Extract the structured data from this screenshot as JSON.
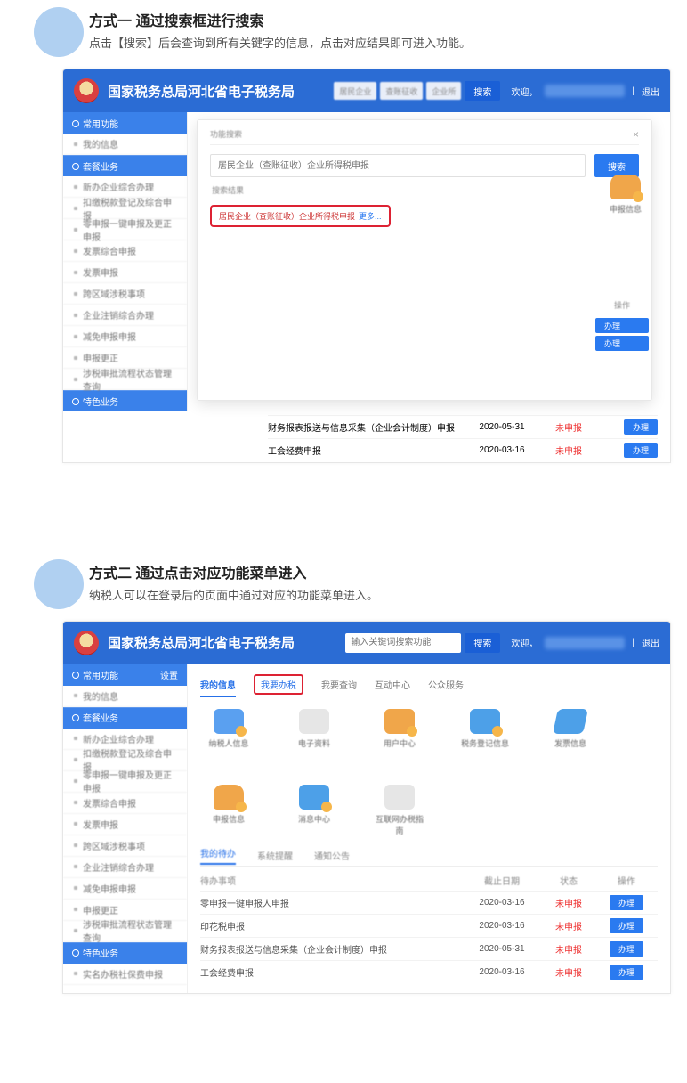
{
  "section1": {
    "title": "方式一 通过搜索框进行搜索",
    "subtitle": "点击【搜索】后会查询到所有关键字的信息，点击对应结果即可进入功能。"
  },
  "section2": {
    "title": "方式二 通过点击对应功能菜单进入",
    "subtitle": "纳税人可以在登录后的页面中通过对应的功能菜单进入。"
  },
  "header": {
    "app_title": "国家税务总局河北省电子税务局",
    "pill1": "居民企业",
    "pill2": "查账征收",
    "pill3": "企业所",
    "search_btn": "搜索",
    "search_placeholder": "输入关键词搜索功能",
    "welcome": "欢迎，",
    "logout": "退出"
  },
  "sidebar": {
    "sec1": "常用功能",
    "sec1_badge": "设置",
    "i_home": "我的信息",
    "sec2": "套餐业务",
    "items": [
      "新办企业综合办理",
      "扣缴税款登记及综合申报",
      "零申报一键申报及更正申报",
      "发票综合申报",
      "发票申报",
      "跨区域涉税事项",
      "企业注销综合办理",
      "减免申报申报",
      "申报更正",
      "涉税审批流程状态管理查询"
    ],
    "sec3": "特色业务",
    "extra": "实名办税社保费申报"
  },
  "tabs": {
    "t1": "我的信息",
    "t2": "我要办税",
    "t3": "我要查询",
    "t4": "互动中心",
    "t5": "公众服务"
  },
  "tiles": {
    "t1": "纳税人信息",
    "t2": "电子资料",
    "t3": "用户中心",
    "t4": "税务登记信息",
    "t5": "发票信息",
    "t6": "申报信息",
    "t7": "消息中心",
    "t8": "互联网办税指南"
  },
  "subtabs": {
    "s1": "我的待办",
    "s2": "系统提醒",
    "s3": "通知公告"
  },
  "table": {
    "h_name": "待办事项",
    "h_due": "截止日期",
    "h_status": "状态",
    "h_op": "操作",
    "rows": [
      {
        "name": "零申报一键申报人申报",
        "due": "2020-03-16",
        "status": "未申报",
        "op": "办理"
      },
      {
        "name": "印花税申报",
        "due": "2020-03-16",
        "status": "未申报",
        "op": "办理"
      },
      {
        "name": "财务报表报送与信息采集（企业会计制度）申报",
        "due": "2020-05-31",
        "status": "未申报",
        "op": "办理"
      },
      {
        "name": "工会经费申报",
        "due": "2020-03-16",
        "status": "未申报",
        "op": "办理"
      }
    ]
  },
  "modal": {
    "title": "功能搜索",
    "placeholder": "居民企业（查账征收）企业所得税申报",
    "btn": "搜索",
    "label": "搜索结果",
    "hit": "居民企业（查账征收）企业所得税申报",
    "hit_more": "更多..."
  }
}
